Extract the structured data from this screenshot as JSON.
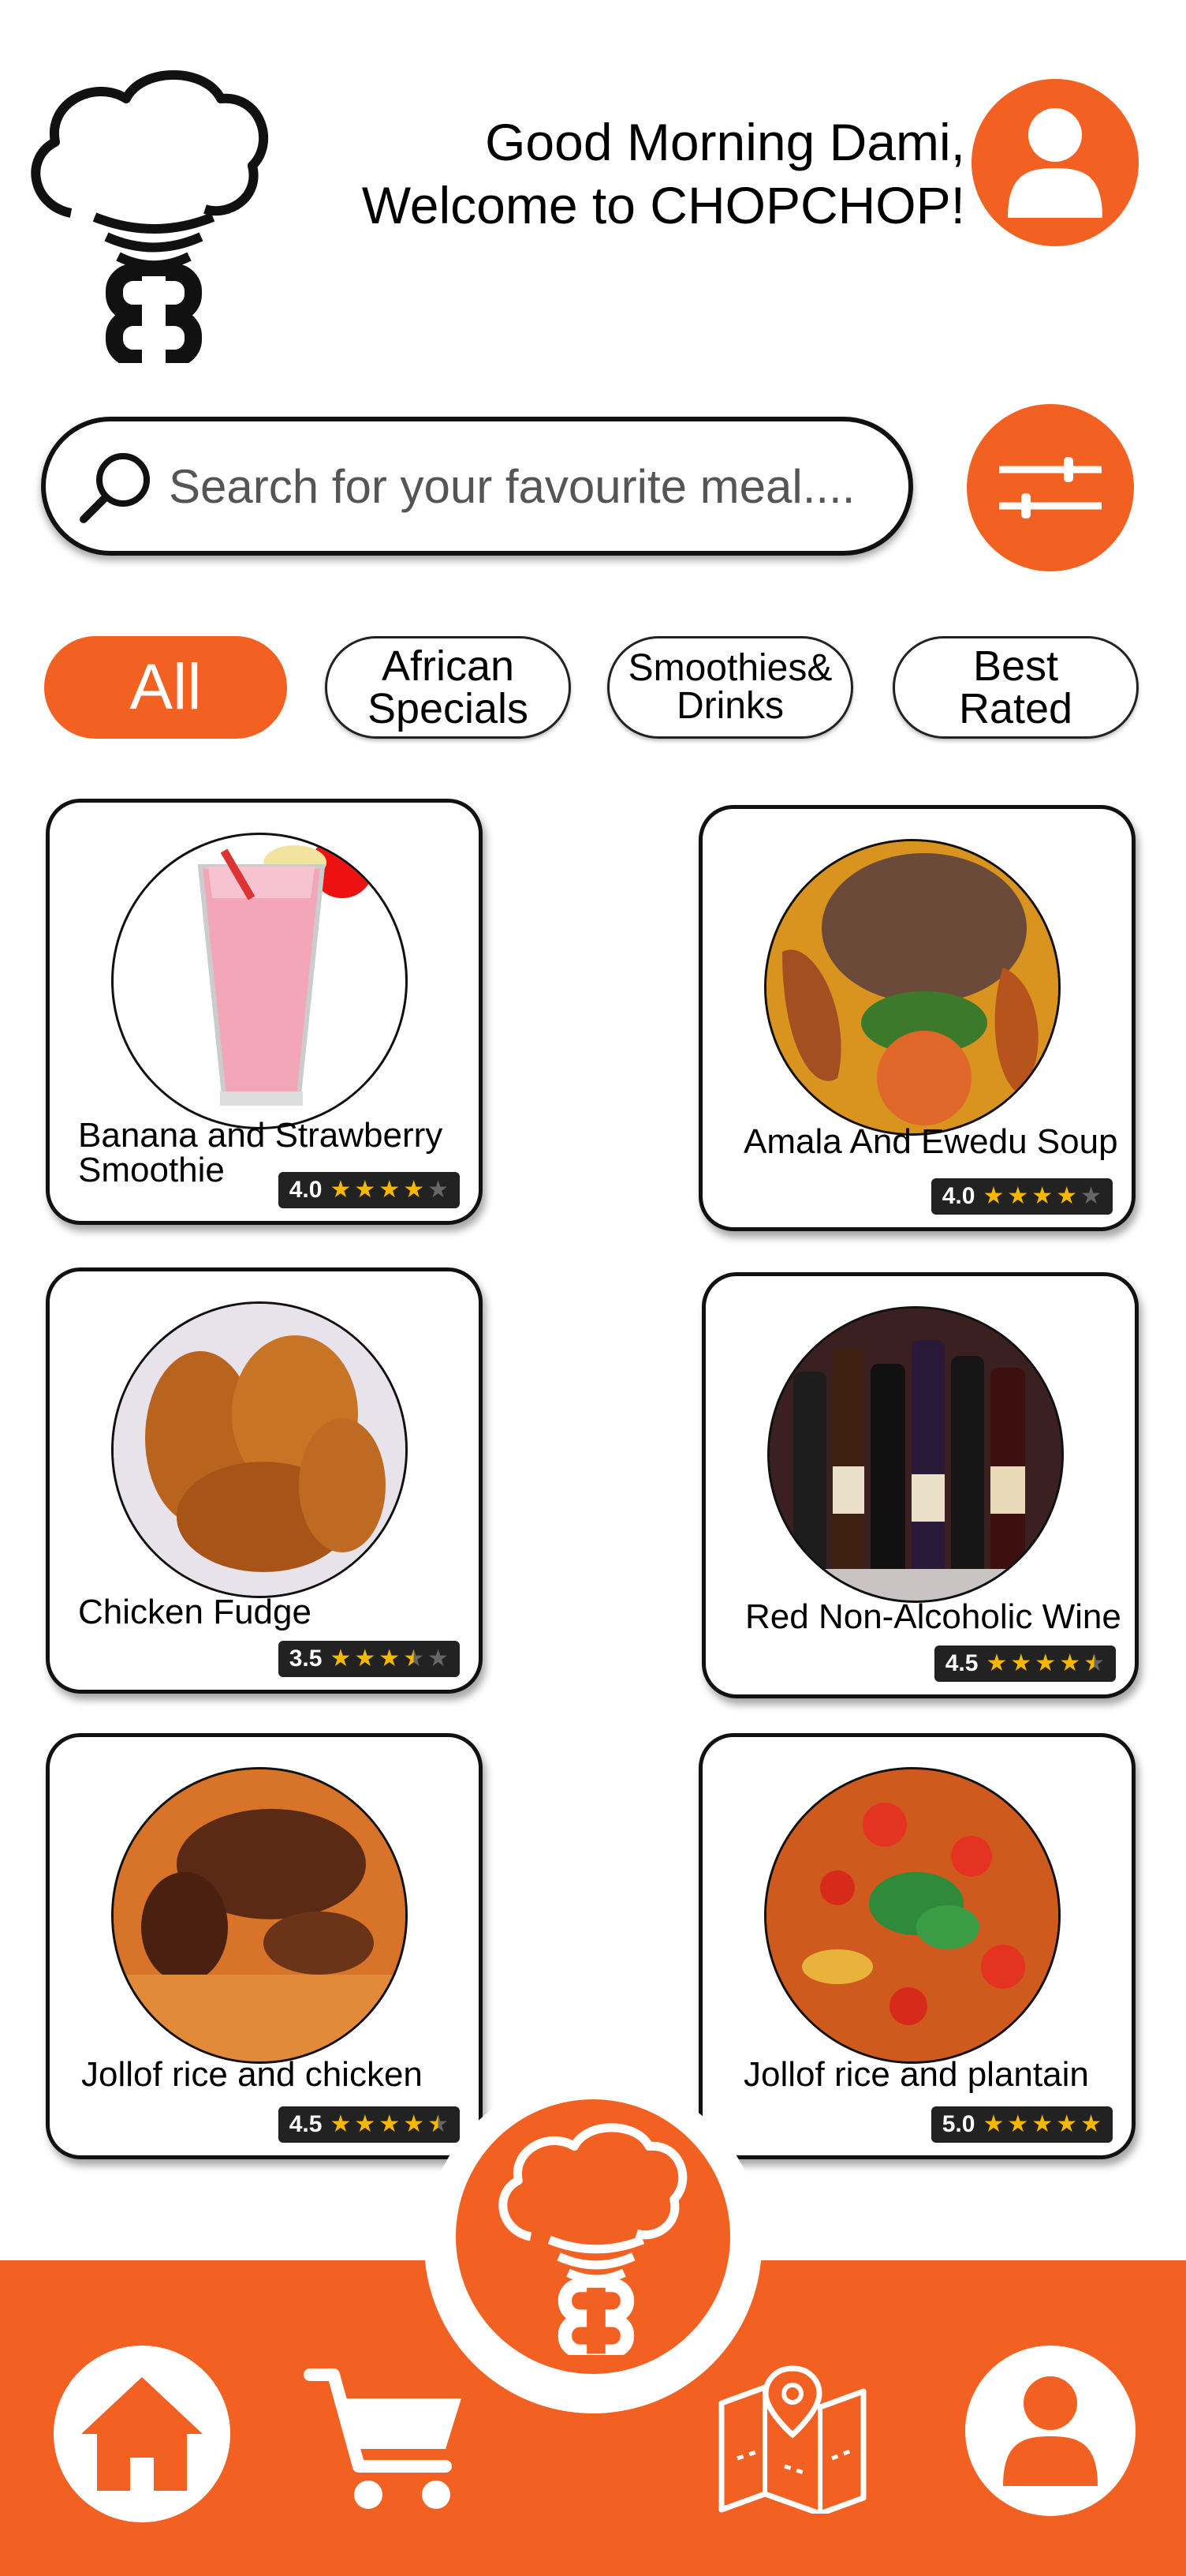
{
  "header": {
    "greeting_line1": "Good Morning Dami,",
    "greeting_line2": "Welcome to CHOPCHOP!"
  },
  "search": {
    "placeholder": "Search for your favourite meal...."
  },
  "categories": [
    {
      "label_line1": "All",
      "label_line2": "",
      "active": true
    },
    {
      "label_line1": "African",
      "label_line2": "Specials",
      "active": false
    },
    {
      "label_line1": "Smoothies&",
      "label_line2": "Drinks",
      "active": false
    },
    {
      "label_line1": "Best",
      "label_line2": "Rated",
      "active": false
    }
  ],
  "products": [
    {
      "name_line1": "Banana and Strawberry",
      "name_line2": "Smoothie",
      "rating": "4.0",
      "stars": 4
    },
    {
      "name_line1": "Amala And Ewedu Soup",
      "name_line2": "",
      "rating": "4.0",
      "stars": 4
    },
    {
      "name_line1": "Chicken Fudge",
      "name_line2": "",
      "rating": "3.5",
      "stars": 3.5
    },
    {
      "name_line1": "Red Non-Alcoholic Wine",
      "name_line2": "",
      "rating": "4.5",
      "stars": 4.5
    },
    {
      "name_line1": "Jollof rice and chicken",
      "name_line2": "",
      "rating": "4.5",
      "stars": 4.5
    },
    {
      "name_line1": "Jollof rice and plantain",
      "name_line2": "",
      "rating": "5.0",
      "stars": 5
    }
  ],
  "nav": {
    "items": [
      "home-icon",
      "cart-icon",
      "chef-logo-icon",
      "map-icon",
      "profile-icon"
    ]
  },
  "colors": {
    "accent": "#f26022",
    "rating_bg": "#222222",
    "star": "#f5b800"
  }
}
